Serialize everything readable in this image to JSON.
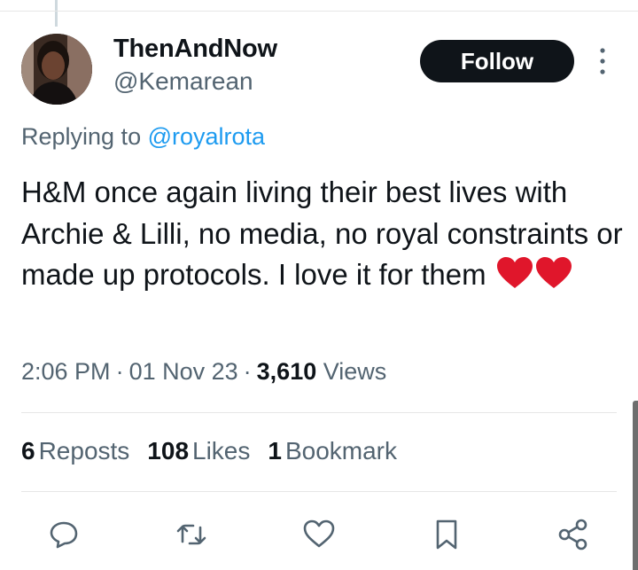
{
  "user": {
    "display_name": "ThenAndNow",
    "handle": "@Kemarean"
  },
  "follow_label": "Follow",
  "reply": {
    "prefix": "Replying to ",
    "mention": "@royalrota"
  },
  "tweet": {
    "text": "H&M once again living their best lives with Archie & Lilli, no media,  no royal constraints or made up protocols.  I love it for them"
  },
  "meta": {
    "time": "2:06 PM",
    "date": "01 Nov 23",
    "views_count": "3,610",
    "views_label": "Views"
  },
  "stats": {
    "reposts_count": "6",
    "reposts_label": "Reposts",
    "likes_count": "108",
    "likes_label": "Likes",
    "bookmarks_count": "1",
    "bookmarks_label": "Bookmark"
  },
  "icons": {
    "reply": "reply-icon",
    "repost": "repost-icon",
    "like": "heart-icon",
    "bookmark": "bookmark-icon",
    "share": "share-icon",
    "more": "more-vertical-icon"
  },
  "colors": {
    "text_primary": "#0f1419",
    "text_secondary": "#536471",
    "link": "#1d9bf0",
    "heart_emoji": "#e0162b"
  }
}
